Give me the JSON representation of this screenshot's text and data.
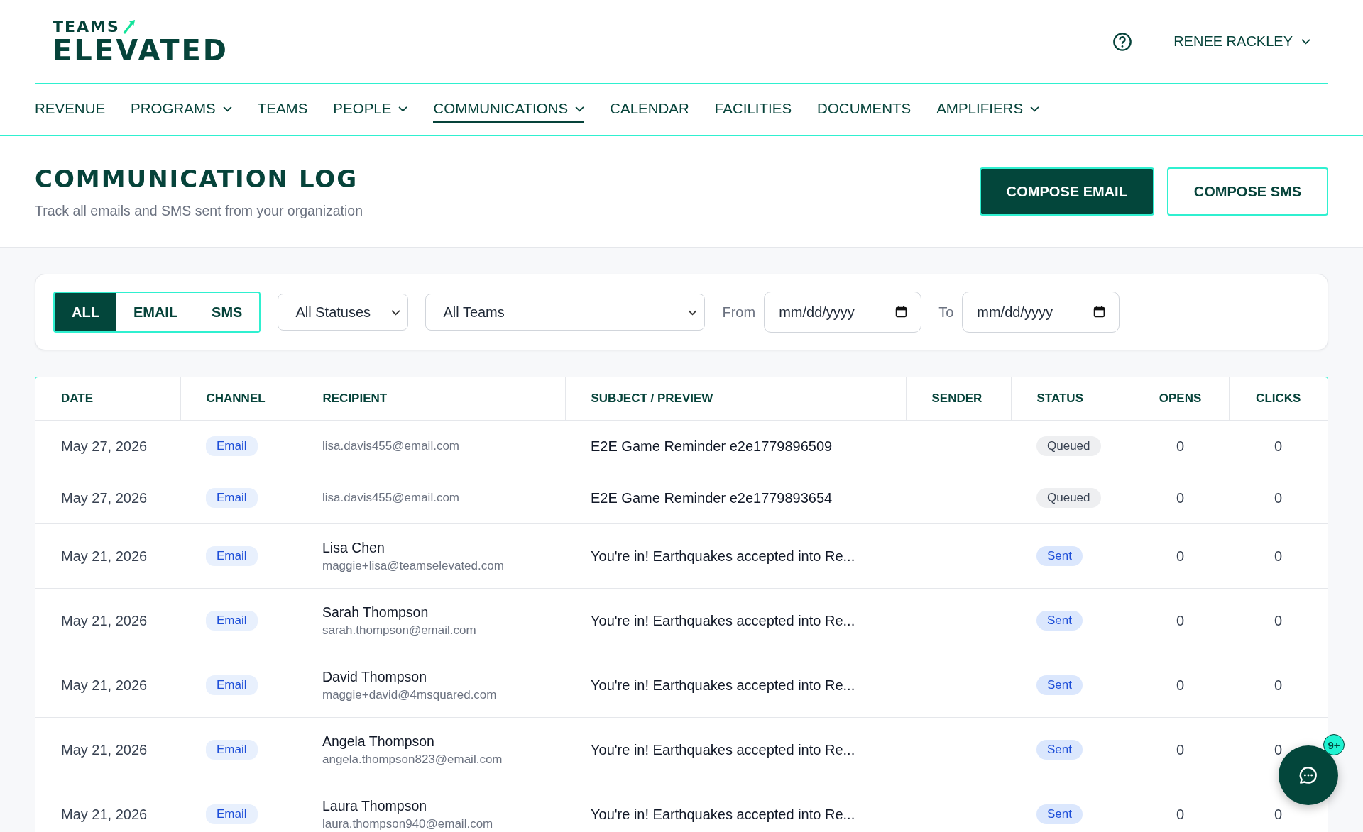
{
  "logo": {
    "line_1": "TEAMS",
    "line_2": "ELEVATED"
  },
  "user_menu": {
    "name": "RENEE RACKLEY"
  },
  "nav": [
    {
      "label": "REVENUE",
      "dropdown": false,
      "selected": false
    },
    {
      "label": "PROGRAMS",
      "dropdown": true,
      "selected": false
    },
    {
      "label": "TEAMS",
      "dropdown": false,
      "selected": false
    },
    {
      "label": "PEOPLE",
      "dropdown": true,
      "selected": false
    },
    {
      "label": "COMMUNICATIONS",
      "dropdown": true,
      "selected": true
    },
    {
      "label": "CALENDAR",
      "dropdown": false,
      "selected": false
    },
    {
      "label": "FACILITIES",
      "dropdown": false,
      "selected": false
    },
    {
      "label": "DOCUMENTS",
      "dropdown": false,
      "selected": false
    },
    {
      "label": "AMPLIFIERS",
      "dropdown": true,
      "selected": false
    }
  ],
  "page": {
    "title": "COMMUNICATION LOG",
    "subtitle": "Track all emails and SMS sent from your organization",
    "buttons": [
      {
        "label": "COMPOSE EMAIL",
        "kind": "primary"
      },
      {
        "label": "COMPOSE SMS",
        "kind": "outline"
      }
    ]
  },
  "filters": {
    "channel_tabs": [
      {
        "label": "ALL",
        "selected": true
      },
      {
        "label": "EMAIL",
        "selected": false
      },
      {
        "label": "SMS",
        "selected": false
      }
    ],
    "status_select": "All Statuses",
    "team_select": "All Teams",
    "from_label": "From",
    "from_date": "mm/dd/yyyy",
    "to_label": "To",
    "to_date": "mm/dd/yyyy"
  },
  "table": {
    "columns": [
      "DATE",
      "CHANNEL",
      "RECIPIENT",
      "SUBJECT / PREVIEW",
      "SENDER",
      "STATUS",
      "OPENS",
      "CLICKS"
    ],
    "rows": [
      {
        "date": "May 27, 2026",
        "channel": "Email",
        "recipient_email": "lisa.davis455@email.com",
        "subject": "E2E Game Reminder e2e1779896509",
        "status": {
          "label": "Queued",
          "kind": "queued"
        },
        "opens": "0",
        "clicks": "0"
      },
      {
        "date": "May 27, 2026",
        "channel": "Email",
        "recipient_email": "lisa.davis455@email.com",
        "subject": "E2E Game Reminder e2e1779893654",
        "status": {
          "label": "Queued",
          "kind": "queued"
        },
        "opens": "0",
        "clicks": "0"
      },
      {
        "date": "May 21, 2026",
        "channel": "Email",
        "recipient_name": "Lisa Chen",
        "recipient_email": "maggie+lisa@teamselevated.com",
        "subject": "You're in! Earthquakes accepted into Re...",
        "status": {
          "label": "Sent",
          "kind": "sent"
        },
        "opens": "0",
        "clicks": "0"
      },
      {
        "date": "May 21, 2026",
        "channel": "Email",
        "recipient_name": "Sarah Thompson",
        "recipient_email": "sarah.thompson@email.com",
        "subject": "You're in! Earthquakes accepted into Re...",
        "status": {
          "label": "Sent",
          "kind": "sent"
        },
        "opens": "0",
        "clicks": "0"
      },
      {
        "date": "May 21, 2026",
        "channel": "Email",
        "recipient_name": "David Thompson",
        "recipient_email": "maggie+david@4msquared.com",
        "subject": "You're in! Earthquakes accepted into Re...",
        "status": {
          "label": "Sent",
          "kind": "sent"
        },
        "opens": "0",
        "clicks": "0"
      },
      {
        "date": "May 21, 2026",
        "channel": "Email",
        "recipient_name": "Angela Thompson",
        "recipient_email": "angela.thompson823@email.com",
        "subject": "You're in! Earthquakes accepted into Re...",
        "status": {
          "label": "Sent",
          "kind": "sent"
        },
        "opens": "0",
        "clicks": "0"
      },
      {
        "date": "May 21, 2026",
        "channel": "Email",
        "recipient_name": "Laura Thompson",
        "recipient_email": "laura.thompson940@email.com",
        "subject": "You're in! Earthquakes accepted into Re...",
        "status": {
          "label": "Sent",
          "kind": "sent"
        },
        "opens": "0",
        "clicks": "0"
      }
    ]
  },
  "chat": {
    "badge": "9+"
  }
}
